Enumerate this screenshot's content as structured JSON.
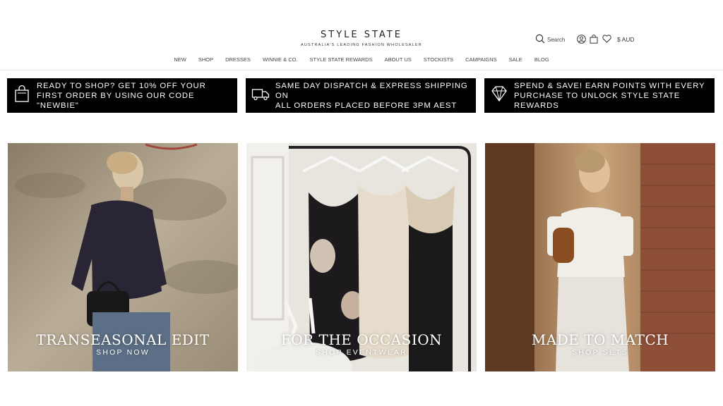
{
  "brand": {
    "name": "STYLE STATE",
    "tagline": "AUSTRALIA'S LEADING FASHION WHOLESALER"
  },
  "header": {
    "search_label": "Search",
    "currency": "$ AUD"
  },
  "nav": [
    "NEW",
    "SHOP",
    "DRESSES",
    "WINNIE & CO.",
    "STYLE STATE REWARDS",
    "ABOUT US",
    "STOCKISTS",
    "CAMPAIGNS",
    "SALE",
    "BLOG"
  ],
  "banners": [
    {
      "icon": "shopping-bag-icon",
      "text": "READY TO SHOP? GET 10% OFF YOUR\nFIRST ORDER BY USING OUR CODE \"NEWBIE\""
    },
    {
      "icon": "delivery-truck-icon",
      "text": "SAME DAY DISPATCH & EXPRESS SHIPPING ON\nALL ORDERS PLACED BEFORE 3PM AEST"
    },
    {
      "icon": "diamond-icon",
      "text": "SPEND & SAVE! EARN POINTS WITH EVERY\nPURCHASE TO UNLOCK STYLE STATE REWARDS"
    }
  ],
  "tiles": [
    {
      "title": "TRANSEASONAL EDIT",
      "cta": "SHOP NOW"
    },
    {
      "title": "FOR THE OCCASION",
      "cta": "SHOP EVENTWEAR"
    },
    {
      "title": "MADE TO MATCH",
      "cta": "SHOP SETS"
    }
  ],
  "colors": {
    "banner_bg": "#000000",
    "text": "#222222",
    "divider": "#e6e6e6"
  }
}
